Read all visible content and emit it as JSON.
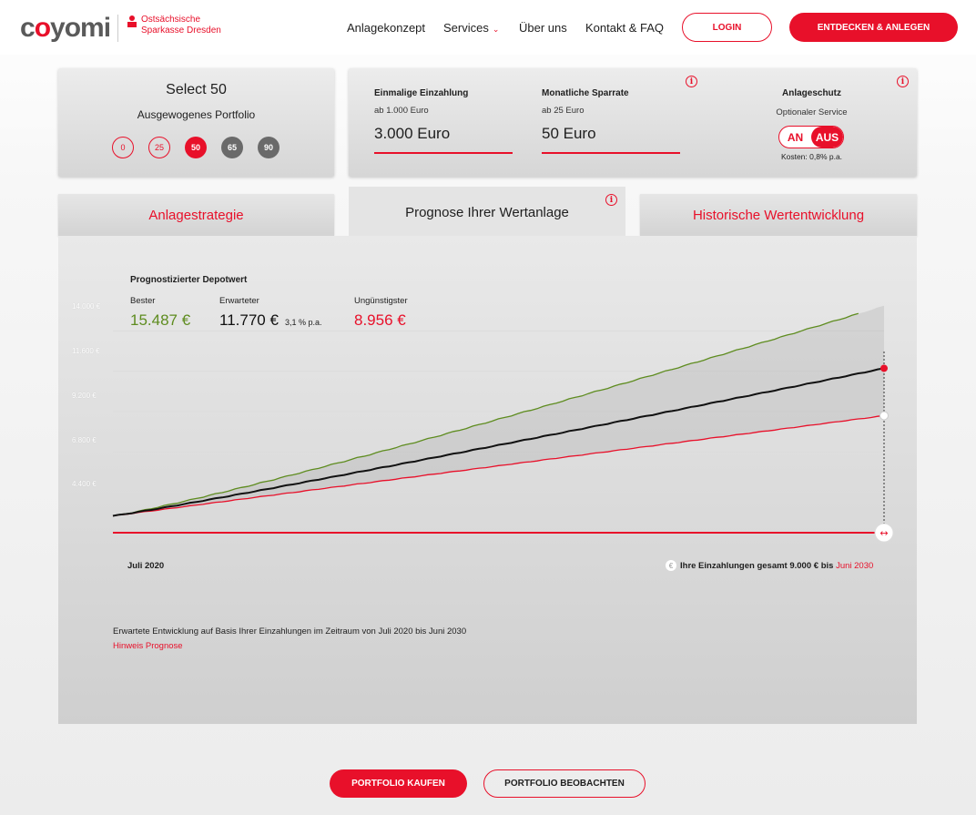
{
  "header": {
    "logo": "coyomi",
    "partner_line1": "Ostsächsische",
    "partner_line2": "Sparkasse Dresden",
    "nav": [
      {
        "label": "Anlagekonzept"
      },
      {
        "label": "Services",
        "chevron": "chevron-down-icon"
      },
      {
        "label": "Über uns"
      },
      {
        "label": "Kontakt & FAQ"
      }
    ],
    "login_label": "LOGIN",
    "cta_label": "ENTDECKEN & ANLEGEN"
  },
  "portfolio": {
    "title": "Select 50",
    "subtitle": "Ausgewogenes Portfolio",
    "options": [
      "0",
      "25",
      "50",
      "65",
      "90"
    ],
    "selected": "50"
  },
  "investment": {
    "one_time_label": "Einmalige Einzahlung",
    "one_time_min": "ab 1.000 Euro",
    "one_time_value": "3.000 Euro",
    "monthly_label": "Monatliche Sparrate",
    "monthly_min": "ab 25 Euro",
    "monthly_value": "50 Euro",
    "protection_label": "Anlageschutz",
    "protection_sub": "Optionaler Service",
    "toggle_on": "AN",
    "toggle_off": "AUS",
    "toggle_state": "AUS",
    "cost": "Kosten: 0,8% p.a."
  },
  "tabs": [
    {
      "label": "Anlagestrategie",
      "active": false
    },
    {
      "label": "Prognose Ihrer Wertanlage",
      "active": true
    },
    {
      "label": "Historische Wertentwicklung",
      "active": false
    }
  ],
  "forecast": {
    "heading": "Prognostizierter Depotwert",
    "best_label": "Bester",
    "best_value": "15.487 €",
    "expected_label": "Erwarteter",
    "expected_value": "11.770 €",
    "expected_rate": "3,1 % p.a.",
    "worst_label": "Ungünstigster",
    "worst_value": "8.956 €",
    "start_label": "Juli 2020",
    "deposits_text": "Ihre Einzahlungen gesamt 9.000 € bis",
    "deposits_until": "Juni 2030",
    "euro_icon": "euro-icon",
    "footnote": "Erwartete Entwicklung auf Basis Ihrer Einzahlungen im Zeitraum von Juli 2020 bis Juni 2030",
    "note_link": "Hinweis Prognose"
  },
  "chart_data": {
    "type": "line",
    "x_range": [
      "Juli 2020",
      "Juni 2030"
    ],
    "y_ticks": [
      "4.400 €",
      "6.800 €",
      "9.200 €",
      "11.600 €",
      "14.000 €"
    ],
    "ylim": [
      2000,
      16500
    ],
    "start_value": 3000,
    "series": [
      {
        "name": "Bester",
        "color": "#5e8c1f",
        "end": 15487
      },
      {
        "name": "Erwarteter",
        "color": "#111111",
        "end": 11770
      },
      {
        "name": "Ungünstigster",
        "color": "#e8102a",
        "end": 8956
      }
    ],
    "deposit_line": {
      "color": "#e8102a"
    }
  },
  "actions": {
    "buy_label": "PORTFOLIO KAUFEN",
    "watch_label": "PORTFOLIO BEOBACHTEN"
  },
  "colors": {
    "accent": "#e8102a",
    "best": "#5e8c1f",
    "expected": "#111111"
  }
}
